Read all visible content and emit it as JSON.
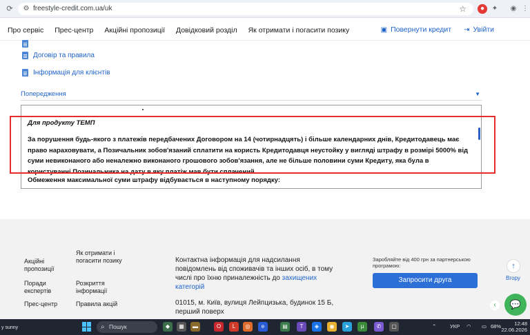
{
  "browser": {
    "url": "freestyle-credit.com.ua/uk"
  },
  "header": {
    "nav": [
      "Про сервіс",
      "Прес-центр",
      "Акційні пропозиції",
      "Довідковий розділ",
      "Як отримати і погасити позику"
    ],
    "return_credit": "Повернути кредит",
    "login": "Увійти"
  },
  "docs": {
    "contract": "Договір та правила",
    "client_info": "Інформація для клієнтів"
  },
  "accordion": {
    "title": "Попередження"
  },
  "textbox": {
    "product_title": "Для продукту ТЕМП",
    "penalty_text": "За порушення будь-якого з платежів передбачених Договором на 14 (чотирнадцять) і більше календарних днів, Кредитодавець має право нараховувати, а Позичальник зобов'язаний сплатити на користь Кредитодавця неустойку у вигляді штрафу в розмірі 5000% від суми невиконаного або неналежно виконаного грошового зобов'язання, але не більше половини суми Кредиту, яка була в користуванні Позичальника на дату в яку платіж мав бути сплачений.",
    "limit_text": "Обмеження максимальної суми штрафу відбувається в наступному порядку:"
  },
  "footer": {
    "col1": [
      "Акційні пропозиції",
      "Поради експертів",
      "Прес-центр"
    ],
    "col2": [
      "Як отримати і погасити позику",
      "Розкриття інформації",
      "Правила акцій"
    ],
    "contact_text": "Контактна інформація для надсилання повідомлень від споживачів та інших осіб, в тому числі про їхню приналежність до",
    "contact_link": "захищених категорій",
    "address_line1": "01015, м. Київ, вулиця Лейпцизька, будинок 15 Б,",
    "address_line2": "перший поверх",
    "partner_note": "Заробляйте від 400 грн за партнерською програмою:",
    "invite_button": "Запросити друга",
    "up_label": "Вгору"
  },
  "taskbar": {
    "weather": "y sunny",
    "search_placeholder": "Пошук",
    "language": "УКР",
    "battery": "68%",
    "time": "12:48",
    "date": "22.06.2026"
  },
  "colors": {
    "accent": "#1e63c9",
    "highlight": "#e52b2b",
    "button": "#2c6fd6",
    "chat": "#3fb45a"
  }
}
